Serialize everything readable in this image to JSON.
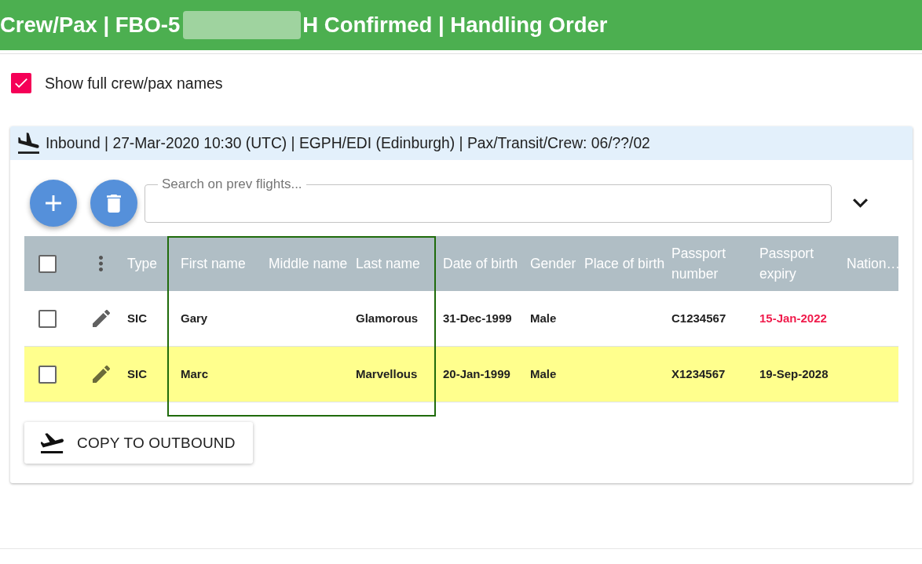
{
  "header": {
    "title_start": "Crew/Pax | FBO-5",
    "redacted": true,
    "title_end": "H Confirmed | Handling Order"
  },
  "show_full_names": {
    "label": "Show full crew/pax names",
    "checked": true
  },
  "flight_panel": {
    "kind": "inbound",
    "title": "Inbound | 27-Mar-2020 10:30 (UTC) | EGPH/EDI (Edinburgh) | Pax/Transit/Crew: 06/??/02",
    "search": {
      "label": "Search on prev flights..."
    },
    "table": {
      "select_all": {
        "checked": false
      },
      "columns": [
        {
          "label": "Type",
          "highlighted": false
        },
        {
          "label": "First name",
          "highlighted": true
        },
        {
          "label": "Middle name",
          "highlighted": true
        },
        {
          "label": "Last name",
          "highlighted": true
        },
        {
          "label": "Date of birth",
          "highlighted": false
        },
        {
          "label": "Gender",
          "highlighted": false
        },
        {
          "label": "Place of birth",
          "highlighted": false
        },
        {
          "label": "Passport number",
          "highlighted": false
        },
        {
          "label": "Passport expiry",
          "highlighted": false
        },
        {
          "label": "Nation…",
          "highlighted": false
        }
      ],
      "rows": [
        {
          "checked": false,
          "highlighted": false,
          "type": "SIC",
          "first_name": "Gary",
          "last_name": "Glamorous",
          "date_of_birth": "31-Dec-1999",
          "gender": "Male",
          "passport_number": "C1234567",
          "passport_expiry": "15-Jan-2022",
          "expiry_warning": true
        },
        {
          "checked": false,
          "highlighted": true,
          "type": "SIC",
          "first_name": "Marc",
          "last_name": "Marvellous",
          "date_of_birth": "20-Jan-1999",
          "gender": "Male",
          "passport_number": "X1234567",
          "passport_expiry": "19-Sep-2028",
          "expiry_warning": false
        }
      ]
    },
    "copy_button": {
      "label": "COPY TO OUTBOUND"
    }
  }
}
